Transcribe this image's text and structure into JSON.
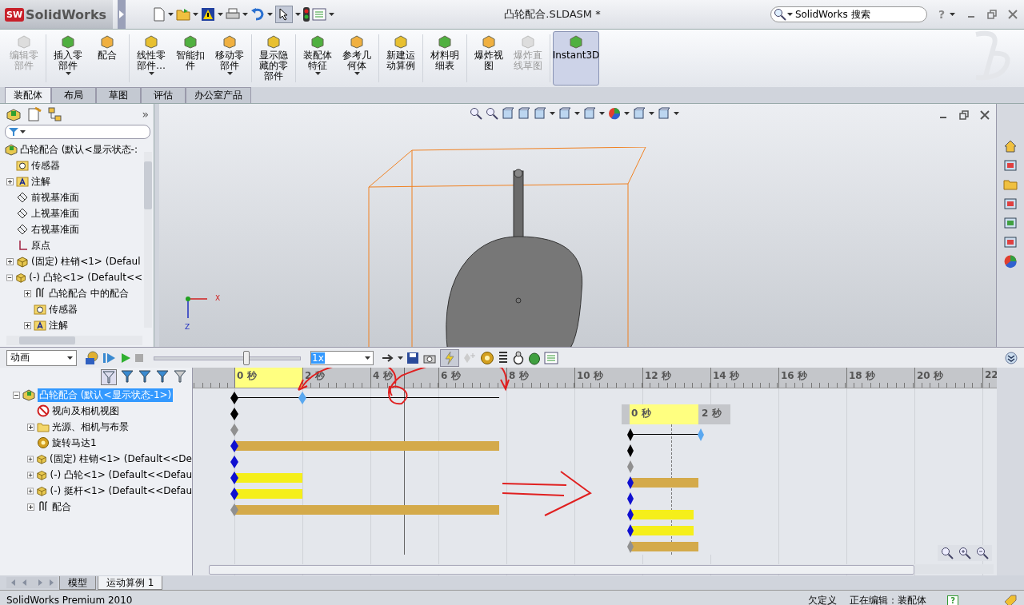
{
  "title_bar": {
    "logo_badge": "SW",
    "app_name": "SolidWorks",
    "document_title": "凸轮配合.SLDASM *",
    "search_placeholder": "SolidWorks 搜索",
    "help": "?"
  },
  "ribbon": [
    {
      "label": "编辑零部件",
      "disabled": true,
      "dropdown": false,
      "selected": false
    },
    {
      "label": "插入零部件",
      "disabled": false,
      "dropdown": true,
      "selected": false
    },
    {
      "label": "配合",
      "disabled": false,
      "dropdown": false,
      "selected": false
    },
    {
      "label": "线性零部件…",
      "disabled": false,
      "dropdown": true,
      "selected": false
    },
    {
      "label": "智能扣件",
      "disabled": false,
      "dropdown": false,
      "selected": false
    },
    {
      "label": "移动零部件",
      "disabled": false,
      "dropdown": true,
      "selected": false
    },
    {
      "label": "显示隐藏的零部件",
      "disabled": false,
      "dropdown": false,
      "selected": false
    },
    {
      "label": "装配体特征",
      "disabled": false,
      "dropdown": true,
      "selected": false
    },
    {
      "label": "参考几何体",
      "disabled": false,
      "dropdown": true,
      "selected": false
    },
    {
      "label": "新建运动算例",
      "disabled": false,
      "dropdown": false,
      "selected": false
    },
    {
      "label": "材料明细表",
      "disabled": false,
      "dropdown": false,
      "selected": false
    },
    {
      "label": "爆炸视图",
      "disabled": false,
      "dropdown": false,
      "selected": false
    },
    {
      "label": "爆炸直线草图",
      "disabled": true,
      "dropdown": false,
      "selected": false
    },
    {
      "label": "Instant3D",
      "disabled": false,
      "dropdown": false,
      "selected": true
    }
  ],
  "command_tabs": [
    {
      "label": "装配体",
      "selected": true
    },
    {
      "label": "布局",
      "selected": false
    },
    {
      "label": "草图",
      "selected": false
    },
    {
      "label": "评估",
      "selected": false
    },
    {
      "label": "办公室产品",
      "selected": false
    }
  ],
  "feature_tree": {
    "more": "»",
    "root": "凸轮配合  (默认<显示状态-:",
    "items": [
      {
        "label": "传感器",
        "kind": "sensor",
        "expandable": false
      },
      {
        "label": "注解",
        "kind": "annotation",
        "expandable": true,
        "expanded": false
      },
      {
        "label": "前视基准面",
        "kind": "plane",
        "expandable": false
      },
      {
        "label": "上视基准面",
        "kind": "plane",
        "expandable": false
      },
      {
        "label": "右视基准面",
        "kind": "plane",
        "expandable": false
      },
      {
        "label": "原点",
        "kind": "origin",
        "expandable": false
      },
      {
        "label": "(固定) 柱销<1> (Defaul",
        "kind": "part",
        "expandable": true,
        "expanded": false
      },
      {
        "label": "(-) 凸轮<1> (Default<<",
        "kind": "part",
        "expandable": true,
        "expanded": true,
        "children": [
          {
            "label": "凸轮配合 中的配合",
            "kind": "mates",
            "expandable": true,
            "expanded": false
          },
          {
            "label": "传感器",
            "kind": "sensor",
            "expandable": false
          },
          {
            "label": "注解",
            "kind": "annotation",
            "expandable": true,
            "expanded": false
          }
        ]
      }
    ]
  },
  "viewport": {
    "triad_labels": [
      "X",
      "Z"
    ]
  },
  "motion": {
    "study_type": "动画",
    "slider": {
      "level": 0.63
    },
    "speed": "1x",
    "ruler": [
      "0 秒",
      "2 秒",
      "4 秒",
      "6 秒",
      "8 秒",
      "10 秒",
      "12 秒",
      "14 秒",
      "16 秒",
      "18 秒",
      "20 秒",
      "22"
    ],
    "tree_root": {
      "label": "凸轮配合  (默认<显示状态-1>)",
      "selected": true,
      "expanded": true
    },
    "rows": [
      {
        "label": "视向及相机视图",
        "kind": "camera",
        "expandable": false,
        "color": "#000000"
      },
      {
        "label": "光源、相机与布景",
        "kind": "lights",
        "expandable": true,
        "expanded": false,
        "color": "#909090"
      },
      {
        "label": "旋转马达1",
        "kind": "motor",
        "expandable": false,
        "color": "#1010d0",
        "bar": {
          "kind": "long",
          "color": "#d4aa4a"
        }
      },
      {
        "label": "(固定) 柱销<1> (Default<<De",
        "kind": "part",
        "expandable": true,
        "expanded": false,
        "color": "#1010d0"
      },
      {
        "label": "(-) 凸轮<1> (Default<<Defau",
        "kind": "part",
        "expandable": true,
        "expanded": false,
        "color": "#1010d0",
        "bar": {
          "kind": "short",
          "color": "#f5ef1a"
        }
      },
      {
        "label": "(-) 挺杆<1> (Default<<Defau",
        "kind": "part",
        "expandable": true,
        "expanded": false,
        "color": "#1010d0",
        "bar": {
          "kind": "short",
          "color": "#f5ef1a"
        }
      },
      {
        "label": "配合",
        "kind": "mates",
        "expandable": true,
        "expanded": false,
        "color": "#909090",
        "bar": {
          "kind": "long",
          "color": "#d4aa4a"
        }
      }
    ],
    "inset": {
      "ruler": [
        "0 秒",
        "2 秒"
      ]
    }
  },
  "bottom_tabs": [
    {
      "label": "模型",
      "selected": false
    },
    {
      "label": "运动算例 1",
      "selected": true
    }
  ],
  "status_bar": {
    "product": "SolidWorks Premium 2010",
    "state": "欠定义",
    "editing": "正在编辑：装配体",
    "help": "?"
  }
}
